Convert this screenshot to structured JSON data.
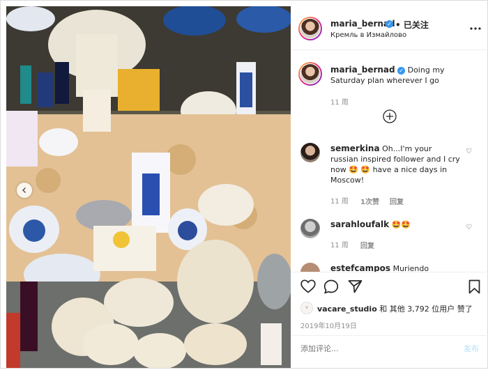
{
  "header": {
    "username": "maria_bernad",
    "follow_status": "• 已关注",
    "location": "Кремль в Измайлово"
  },
  "caption": {
    "username": "maria_bernad",
    "text": "Doing my Saturday plan wherever I go",
    "age": "11 周"
  },
  "comments": [
    {
      "username": "semerkina",
      "text": "Oh...I'm your russian inspired follower and I cry now 🤩 🤩 have a nice days in Moscow!",
      "age": "11 周",
      "likes": "1次赞",
      "reply": "回复"
    },
    {
      "username": "sarahloufalk",
      "text": "🤩🤩",
      "age": "11 周",
      "reply": "回复"
    },
    {
      "username": "estefcampos",
      "text": "Muriendo"
    }
  ],
  "likes_line": {
    "liker": "vacare_studio",
    "rest": "和 其他 3,792 位用户 赞了"
  },
  "date": "2019年10月19日",
  "add_comment": {
    "placeholder": "添加评论...",
    "post_label": "发布"
  },
  "icons": {
    "more": "more-options-icon",
    "like": "heart-icon",
    "comment": "comment-icon",
    "share": "share-icon",
    "save": "bookmark-icon",
    "load_more": "plus-circle-icon"
  }
}
